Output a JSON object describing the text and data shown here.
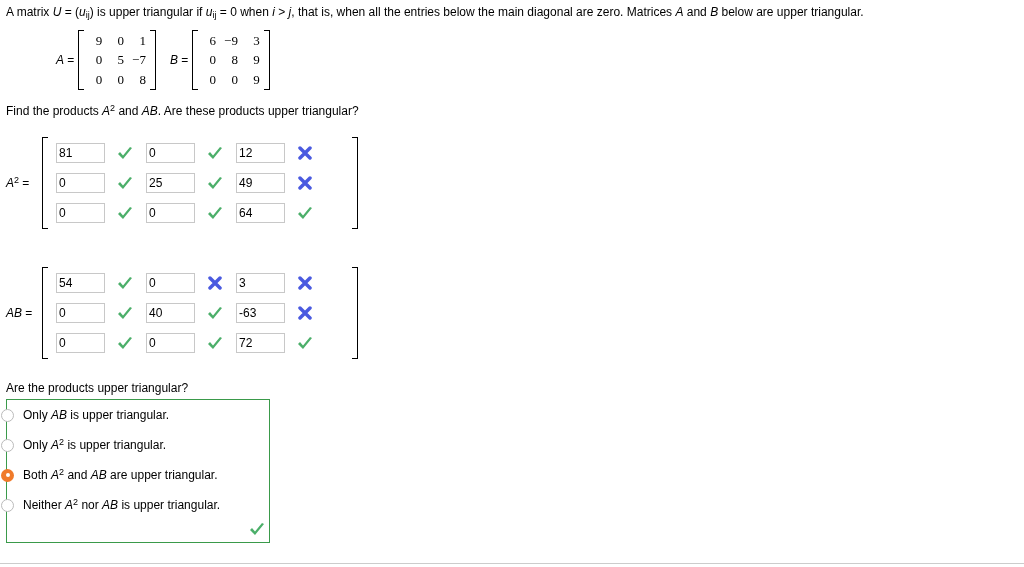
{
  "intro": "A matrix *U* = (*u*$_{ij}$) is upper triangular if *u*$_{ij}$ = 0 when *i* > *j*, that is, when all the entries below the main diagonal are zero. Matrices *A* and *B* below are upper triangular.",
  "given": [
    {
      "label": "*A* =",
      "rows": [
        [
          "9",
          "0",
          "1"
        ],
        [
          "0",
          "5",
          "−7"
        ],
        [
          "0",
          "0",
          "8"
        ]
      ]
    },
    {
      "label": "*B* =",
      "rows": [
        [
          "6",
          "−9",
          "3"
        ],
        [
          "0",
          "8",
          "9"
        ],
        [
          "0",
          "0",
          "9"
        ]
      ]
    }
  ],
  "prompt": "Find the products *A*$^{2}$ and *AB*. Are these products upper triangular?",
  "answers": [
    {
      "label": "*A*$^{2}$ =",
      "rows": [
        [
          {
            "value": "81",
            "correct": true
          },
          {
            "value": "0",
            "correct": true
          },
          {
            "value": "12",
            "correct": false
          }
        ],
        [
          {
            "value": "0",
            "correct": true
          },
          {
            "value": "25",
            "correct": true
          },
          {
            "value": "49",
            "correct": false
          }
        ],
        [
          {
            "value": "0",
            "correct": true
          },
          {
            "value": "0",
            "correct": true
          },
          {
            "value": "64",
            "correct": true
          }
        ]
      ]
    },
    {
      "label": "*AB* =",
      "rows": [
        [
          {
            "value": "54",
            "correct": true
          },
          {
            "value": "0",
            "correct": false
          },
          {
            "value": "3",
            "correct": false
          }
        ],
        [
          {
            "value": "0",
            "correct": true
          },
          {
            "value": "40",
            "correct": true
          },
          {
            "value": "-63",
            "correct": false
          }
        ],
        [
          {
            "value": "0",
            "correct": true
          },
          {
            "value": "0",
            "correct": true
          },
          {
            "value": "72",
            "correct": true
          }
        ]
      ]
    }
  ],
  "question": "Are the products upper triangular?",
  "options": [
    {
      "label": "Only *AB* is upper triangular.",
      "selected": false
    },
    {
      "label": "Only *A*$^{2}$ is upper triangular.",
      "selected": false
    },
    {
      "label": "Both *A*$^{2}$ and *AB* are upper triangular.",
      "selected": true
    },
    {
      "label": "Neither *A*$^{2}$ nor *AB* is upper triangular.",
      "selected": false
    }
  ],
  "question_correct": true
}
